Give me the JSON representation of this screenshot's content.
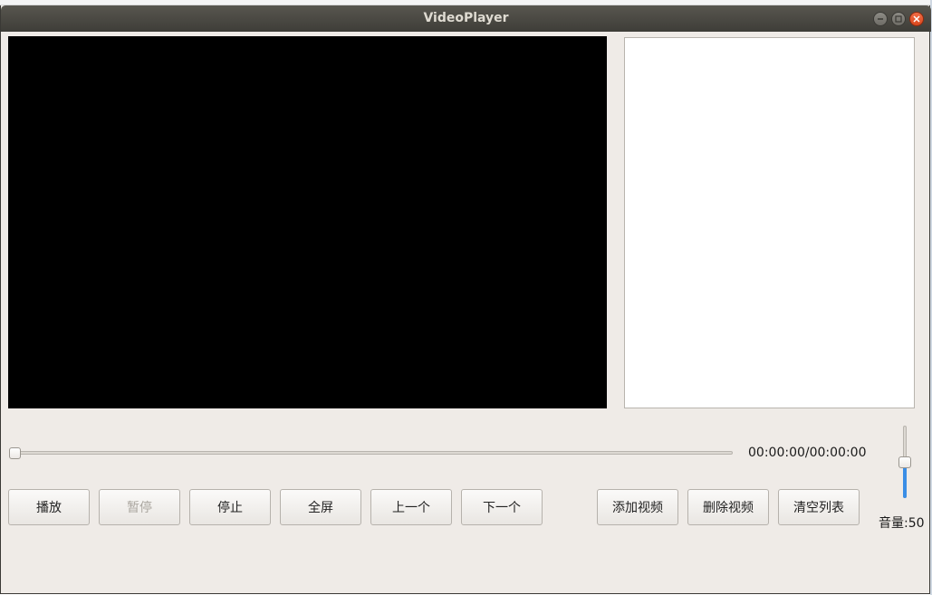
{
  "window": {
    "title": "VideoPlayer"
  },
  "player": {
    "time_display": "00:00:00/00:00:00",
    "progress": 0,
    "volume_label": "音量:50",
    "volume": 50,
    "accent_color": "#3a8ee6"
  },
  "controls": {
    "play": "播放",
    "pause": "暂停",
    "stop": "停止",
    "fullscreen": "全屏",
    "previous": "上一个",
    "next": "下一个",
    "add_video": "添加视频",
    "delete_video": "删除视频",
    "clear_list": "清空列表"
  },
  "playlist": {
    "items": []
  }
}
